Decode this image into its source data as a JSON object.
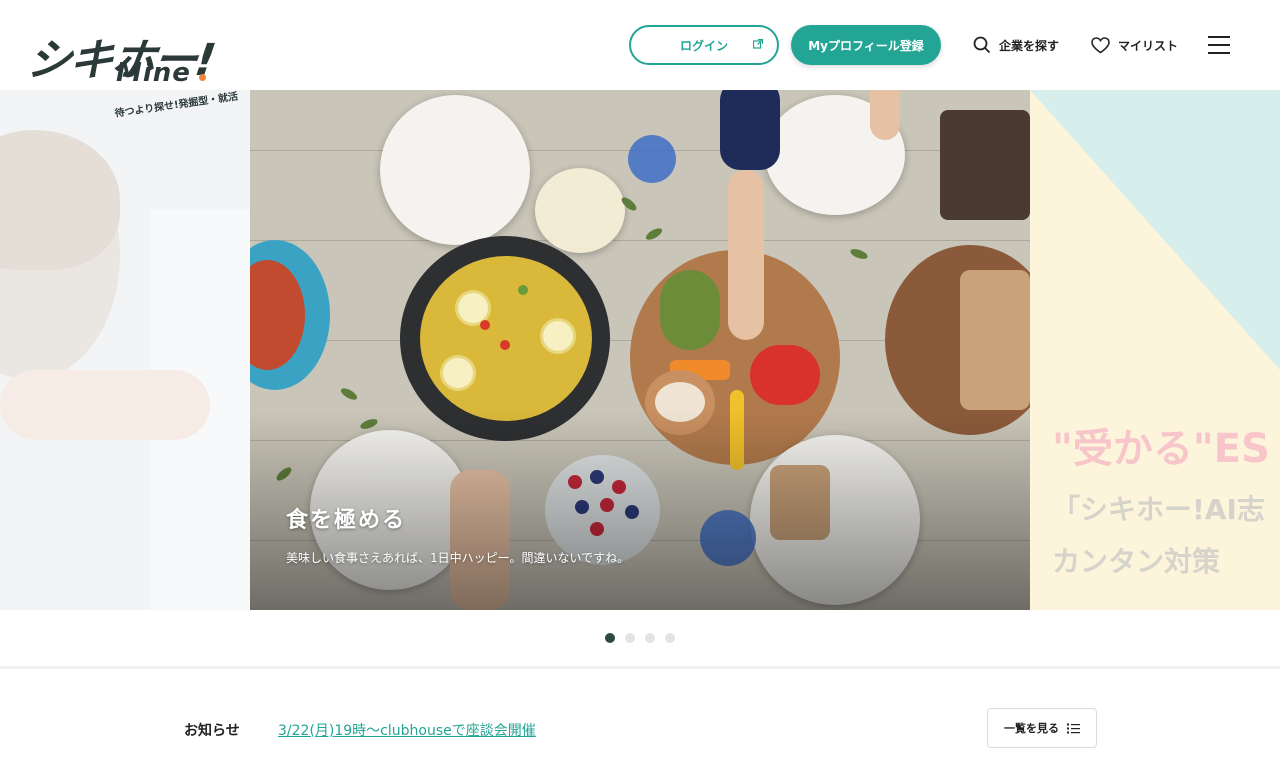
{
  "brand": {
    "logo_main": "シキホー!",
    "logo_sub": "Mine",
    "tagline": "待つより探せ!発掘型・就活"
  },
  "header": {
    "login_label": "ログイン",
    "register_label": "Myプロフィール登録",
    "search_label": "企業を探す",
    "mylist_label": "マイリスト",
    "accent_color": "#22a595"
  },
  "carousel": {
    "active_slide": {
      "title": "食を極める",
      "subtitle": "美味しい食事さえあれば、1日中ハッピー。間違いないですね。"
    },
    "next_slide": {
      "line1": "\"受かる\"ES",
      "line2": "「シキホー!AI志",
      "line3": "カンタン対策"
    },
    "dot_count": 4,
    "active_index": 1
  },
  "news": {
    "label": "お知らせ",
    "headline": "3/22(月)19時〜clubhouseで座談会開催",
    "view_all_label": "一覧を見る"
  }
}
